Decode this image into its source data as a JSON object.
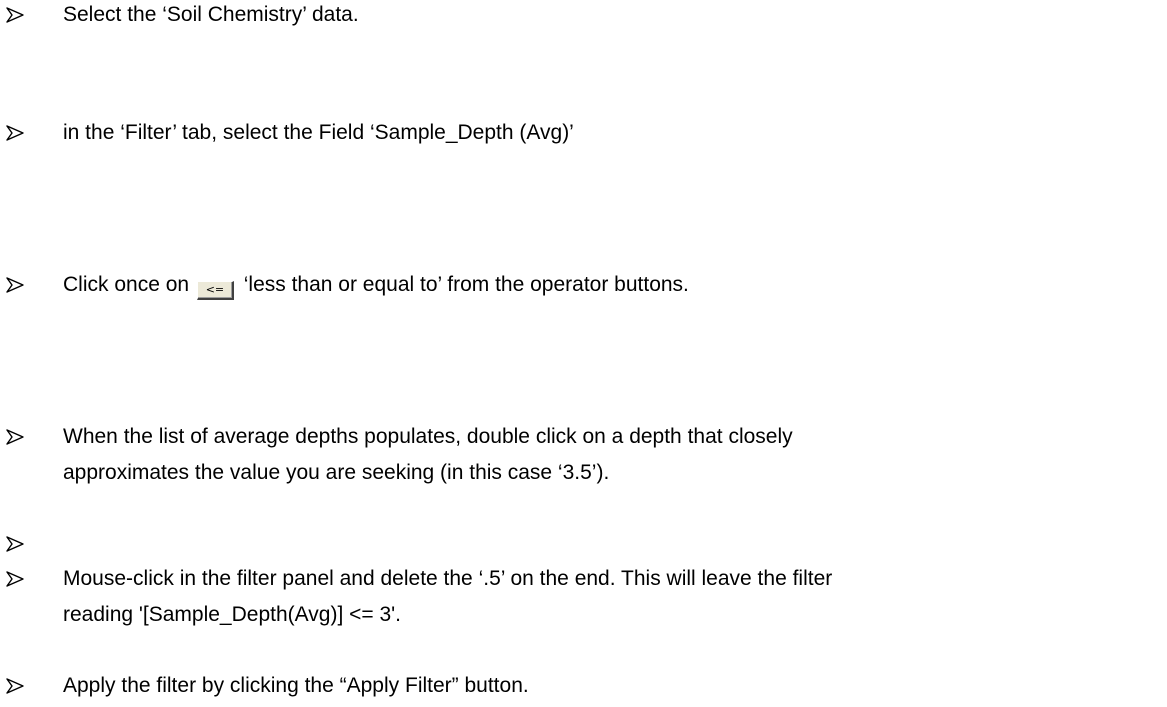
{
  "steps": [
    {
      "lines": [
        "Select the ‘Soil Chemistry’ data."
      ]
    },
    {
      "lines": [
        "in the ‘Filter’ tab, select the Field ‘Sample_Depth (Avg)’"
      ]
    },
    {
      "before": "Click once on",
      "button_label": "<=",
      "after": "‘less than or equal to’ from the operator buttons."
    },
    {
      "lines": [
        "When the list of average depths populates, double click on a depth that closely",
        "approximates the value you are seeking (in this case ‘3.5’)."
      ]
    },
    {
      "lines": [
        ""
      ]
    },
    {
      "lines": [
        "Mouse-click in the filter panel and delete the ‘.5’ on the end.  This will leave the filter",
        "reading '[Sample_Depth(Avg)] <= 3'."
      ]
    },
    {
      "lines": [
        "Apply the filter by clicking the “Apply Filter” button."
      ]
    }
  ],
  "icons": {
    "bullet": "arrow-bullet-icon"
  }
}
